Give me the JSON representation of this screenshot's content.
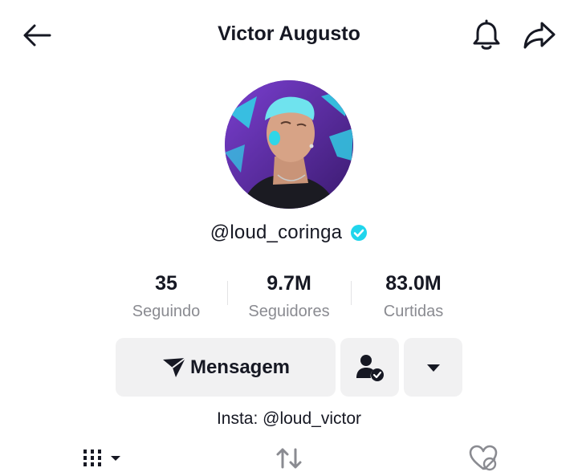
{
  "header": {
    "title": "Victor Augusto",
    "back_icon": "arrow-left-icon",
    "bell_icon": "bell-icon",
    "share_icon": "share-arrow-icon"
  },
  "profile": {
    "handle": "@loud_coringa",
    "verified": true,
    "verified_color": "#20d5ec",
    "bio": "Insta: @loud_victor"
  },
  "stats": [
    {
      "value": "35",
      "label": "Seguindo"
    },
    {
      "value": "9.7M",
      "label": "Seguidores"
    },
    {
      "value": "83.0M",
      "label": "Curtidas"
    }
  ],
  "actions": {
    "message_label": "Mensagem",
    "message_icon": "send-plane-icon",
    "follow_icon": "user-check-icon",
    "more_icon": "caret-down-icon"
  },
  "tabs": [
    {
      "icon": "grid-bars-icon",
      "active": true
    },
    {
      "icon": "repost-icon",
      "active": false
    },
    {
      "icon": "hidden-heart-icon",
      "active": false
    }
  ],
  "colors": {
    "text": "#161823",
    "secondary_text": "#8a8b91",
    "button_bg": "#f1f1f2",
    "avatar_bg": "#5b2a9a",
    "avatar_accent": "#2fd6e8"
  }
}
